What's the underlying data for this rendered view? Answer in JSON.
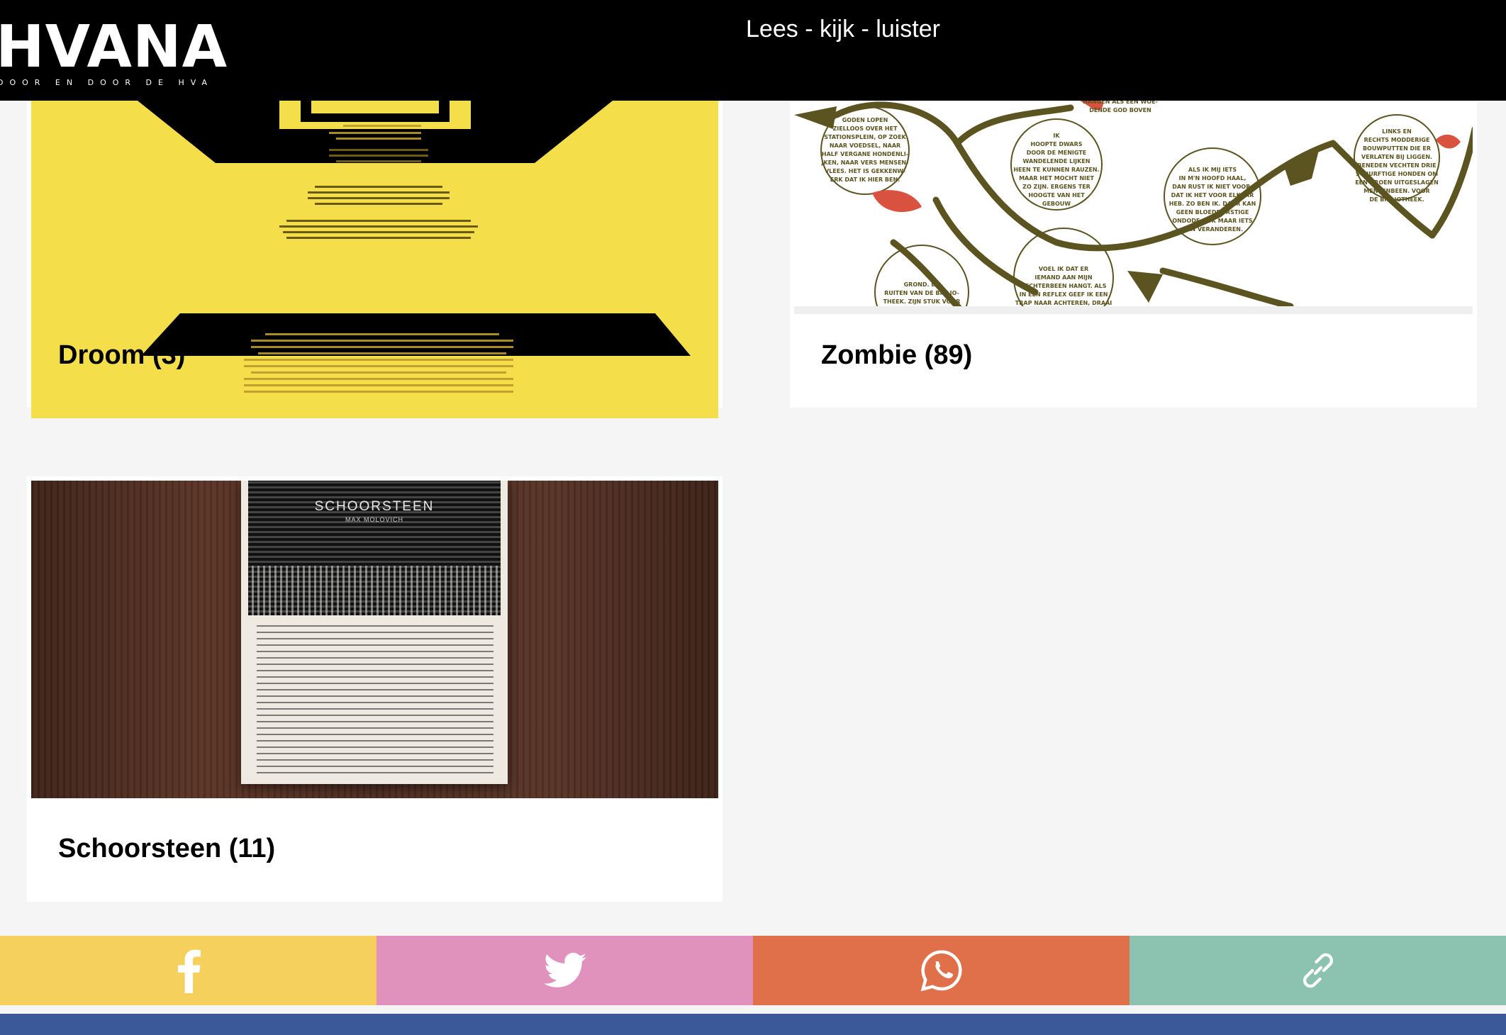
{
  "header": {
    "logo_text": "HVANA",
    "logo_subtext": "DOOR EN DOOR DE HVA",
    "title": "Lees - kijk - luister"
  },
  "cards": [
    {
      "title": "Droom (3)"
    },
    {
      "title": "Zombie (89)"
    },
    {
      "title": "Schoorsteen (11)"
    }
  ],
  "artwork": {
    "schoorsteen_title": "SCHOORSTEEN",
    "schoorsteen_author": "MAX MOLOVICH"
  },
  "share": [
    {
      "icon": "facebook-icon",
      "color": "#f5d05c"
    },
    {
      "icon": "twitter-icon",
      "color": "#e092bc"
    },
    {
      "icon": "whatsapp-icon",
      "color": "#e0704a"
    },
    {
      "icon": "link-icon",
      "color": "#8bc3b0"
    }
  ],
  "colors": {
    "header_bg": "#000000",
    "page_bg": "#f5f5f5",
    "bottom_strip": "#3b5998"
  }
}
